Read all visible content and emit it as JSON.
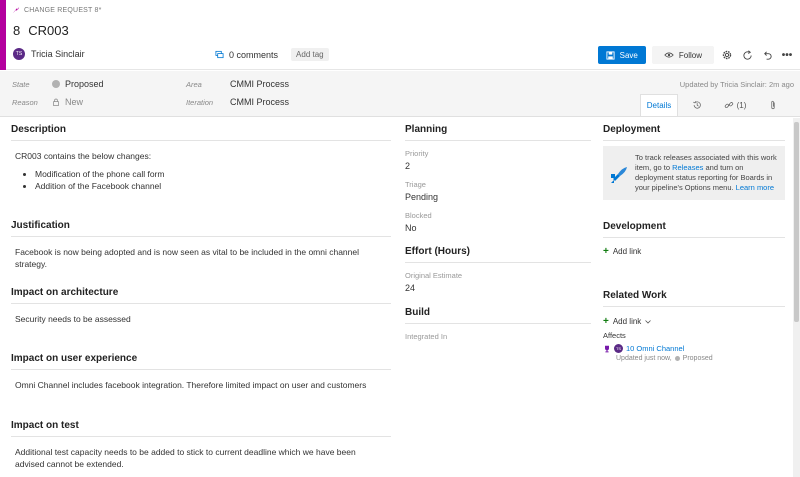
{
  "header": {
    "type_label": "CHANGE REQUEST 8*",
    "id": "8",
    "title": "CR003",
    "owner_initials": "TS",
    "owner_name": "Tricia Sinclair",
    "comments": "0 comments",
    "add_tag": "Add tag"
  },
  "toolbar": {
    "save_label": "Save",
    "follow_label": "Follow"
  },
  "fields": {
    "state_label": "State",
    "state_value": "Proposed",
    "reason_label": "Reason",
    "reason_value": "New",
    "area_label": "Area",
    "area_value": "CMMI Process",
    "iteration_label": "Iteration",
    "iteration_value": "CMMI Process",
    "updated_by": "Updated by Tricia Sinclair: 2m ago"
  },
  "tabs": {
    "details": "Details",
    "links_count": "(1)"
  },
  "description": {
    "title": "Description",
    "text": "CR003 contains the below changes:",
    "bullets": [
      "Modification of the phone call form",
      "Addition of the Facebook channel"
    ]
  },
  "justification": {
    "title": "Justification",
    "text": "Facebook is now being adopted and is now seen as vital to be included in the omni channel strategy."
  },
  "impact_architecture": {
    "title": "Impact on architecture",
    "text": "Security needs to be assessed"
  },
  "impact_ux": {
    "title": "Impact on user experience",
    "text": "Omni Channel includes facebook integration. Therefore limited impact on user and customers"
  },
  "impact_test": {
    "title": "Impact on test",
    "text": "Additional test capacity needs to be added to stick to current deadline which we have been advised cannot be extended."
  },
  "planning": {
    "title": "Planning",
    "priority_label": "Priority",
    "priority_value": "2",
    "triage_label": "Triage",
    "triage_value": "Pending",
    "blocked_label": "Blocked",
    "blocked_value": "No"
  },
  "effort": {
    "title": "Effort (Hours)",
    "estimate_label": "Original Estimate",
    "estimate_value": "24"
  },
  "build": {
    "title": "Build",
    "integrated_label": "Integrated In"
  },
  "deployment": {
    "title": "Deployment",
    "text_1": "To track releases associated with this work item, go to",
    "releases_link": "Releases",
    "text_2": "and turn on deployment status reporting for Boards in your pipeline's Options menu.",
    "learn_more": "Learn more"
  },
  "development": {
    "title": "Development",
    "add_link": "Add link"
  },
  "related_work": {
    "title": "Related Work",
    "add_link": "Add link",
    "affects_label": "Affects",
    "item_initials": "TS",
    "item_link": "10 Omni Channel",
    "item_updated": "Updated just now,",
    "item_state": "Proposed"
  },
  "colors": {
    "accent": "#b4009e",
    "primary": "#0078d4",
    "add_green": "#107c10"
  }
}
